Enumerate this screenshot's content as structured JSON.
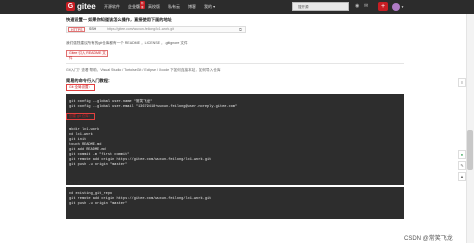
{
  "navbar": {
    "logo_letter": "G",
    "logo_text": "gitee",
    "items": [
      {
        "label": "开源软件",
        "active": false
      },
      {
        "label": "企业版",
        "active": true,
        "badge": "特惠"
      },
      {
        "label": "高校版",
        "active": false
      },
      {
        "label": "私有云",
        "active": false
      },
      {
        "label": "博客",
        "active": false
      },
      {
        "label": "我的 ▾",
        "active": false
      }
    ],
    "search_placeholder": "搜开源",
    "add_label": "+"
  },
  "content": {
    "quick_setup": "快速设置— 如果你知道该怎么操作，直接使用下面的地址",
    "protocols": [
      "HTTPS",
      "SSH"
    ],
    "repo_url": "https://gitee.com/wuxun-feilong/lc1-work.git",
    "recommend_text": "我们强烈建议所有的git仓库都有一个 README ，LICENSE ，.gitignore 文件",
    "notice_label": "Gitee 引入 README 文件",
    "ide_text": "Git入门？查看 帮助，Visual Studio / TortoiseGit / Eclipse / Xcode 下如何连接本站，如何导入仓库",
    "cli_heading": "简易的命令行入门教程：",
    "git_global_label": "Git 全局设置：",
    "global_commands": [
      "git config --global user.name \"常笑飞龙\"",
      "git config --global user.email \"13679418+wuxun-feilong@user.noreply.gitee.com\""
    ],
    "create_repo_label": "创建 git 仓库：",
    "create_commands": [
      "mkdir lc1-work",
      "cd lc1-work",
      "git init",
      "touch README.md",
      "git add README.md",
      "git commit -m \"first commit\"",
      "git remote add origin https://gitee.com/wuxun-feilong/lc1-work.git",
      "git push -u origin \"master\""
    ],
    "existing_label": "已有仓库？",
    "existing_commands": [
      "cd existing_git_repo",
      "git remote add origin https://gitee.com/wuxun-feilong/lc1-work.git",
      "git push -u origin \"master\""
    ]
  },
  "watermark": "CSDN @常笑飞龙",
  "colors": {
    "brand": "#c71d23",
    "navbar": "#2c2c2c",
    "code_bg": "#2d2d2d"
  }
}
